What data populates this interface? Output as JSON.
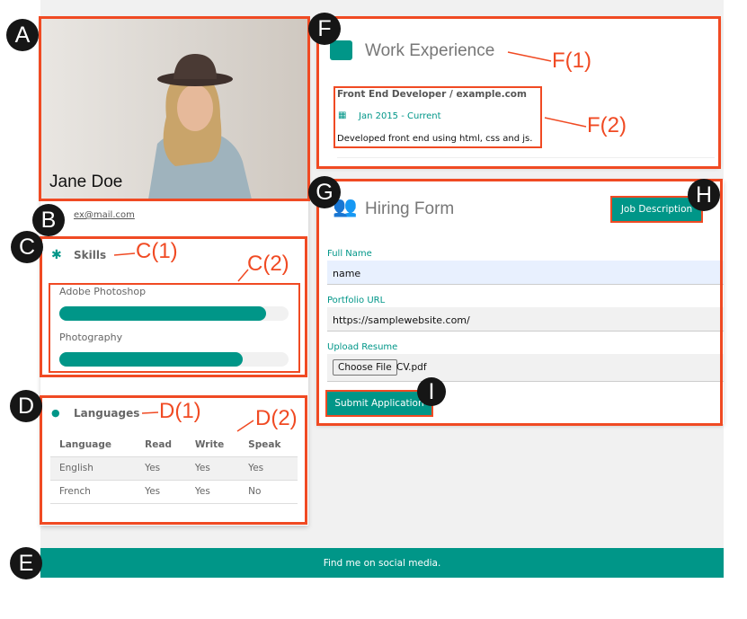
{
  "profile": {
    "name": "Jane Doe",
    "email": "ex@mail.com"
  },
  "skills": {
    "title": "Skills",
    "icon": "asterisk-icon",
    "items": [
      {
        "label": "Adobe Photoshop",
        "level_percent": 90
      },
      {
        "label": "Photography",
        "level_percent": 80
      }
    ]
  },
  "languages": {
    "title": "Languages",
    "icon": "globe-icon",
    "headers": [
      "Language",
      "Read",
      "Write",
      "Speak"
    ],
    "rows": [
      [
        "English",
        "Yes",
        "Yes",
        "Yes"
      ],
      [
        "French",
        "Yes",
        "Yes",
        "No"
      ]
    ]
  },
  "footer": {
    "text": "Find me on social media."
  },
  "work": {
    "title": "Work Experience",
    "icon": "suitcase-icon",
    "job_title": "Front End Developer / example.com",
    "date": "Jan 2015 - Current",
    "description": "Developed front end using html, css and js."
  },
  "hiring": {
    "title": "Hiring Form",
    "icon": "users-icon",
    "job_description_label": "Job Description",
    "full_name_label": "Full Name",
    "full_name_value": "name",
    "portfolio_label": "Portfolio URL",
    "portfolio_value": "https://samplewebsite.com/",
    "resume_label": "Upload Resume",
    "choose_file_label": "Choose File",
    "file_name": "CV.pdf",
    "submit_label": "Submit Application"
  },
  "annotations": {
    "A": "A",
    "B": "B",
    "C": "C",
    "D": "D",
    "E": "E",
    "F": "F",
    "G": "G",
    "H": "H",
    "I": "I",
    "C1": "C(1)",
    "C2": "C(2)",
    "D1": "D(1)",
    "D2": "D(2)",
    "F1": "F(1)",
    "F2": "F(2)"
  },
  "colors": {
    "accent": "#009688",
    "annotation": "#f04a23"
  }
}
